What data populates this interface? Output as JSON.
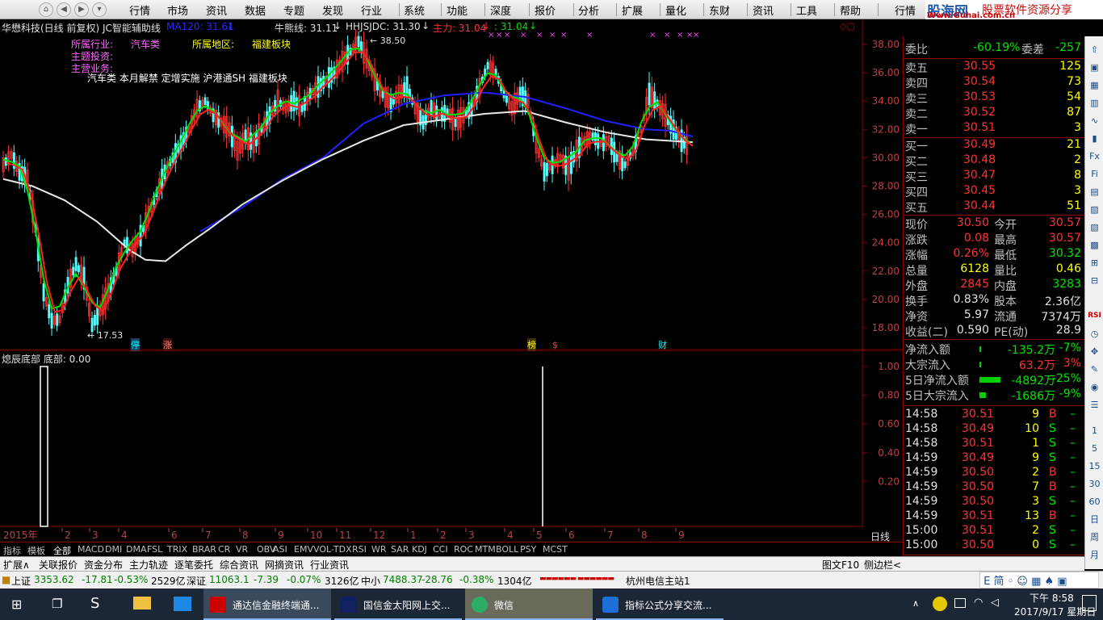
{
  "menubar": {
    "items": [
      "行情",
      "市场",
      "资讯",
      "数据",
      "专题",
      "发现",
      "行业",
      "系统",
      "功能",
      "深度",
      "报价",
      "分析",
      "扩展",
      "量化",
      "东财",
      "资讯",
      "工具",
      "帮助",
      "行情"
    ],
    "logo_main": "股海网",
    "logo_slogan": "股票软件资源分享",
    "logo_url": "Www.Guhai.com.cn"
  },
  "chart_header": {
    "title": "华懋科技(日线 前复权) JC智能辅助线",
    "ma120": "MA120: 31.61",
    "niu": "牛熊线: 31.11",
    "hhjs": "HHJSJDC: 31.30",
    "zhuli": "主力: 31.04",
    "extra": ": 31.04"
  },
  "info": {
    "industry_label": "所属行业:",
    "industry_value": "汽车类",
    "region_label": "所属地区:",
    "region_value": "福建板块",
    "invest_label": "主题投资:",
    "business_label": "主营业务:",
    "concepts": "汽车类 本月解禁 定增实施 沪港通SH 福建板块"
  },
  "markers": {
    "high": "38.50",
    "low": "17.53",
    "m1": "停",
    "m2": "涨",
    "m3": "榜",
    "m4": "$",
    "m5": "财"
  },
  "chart_data": [
    {
      "type": "line",
      "title": "华懋科技(日线 前复权)",
      "ylim": [
        17,
        39
      ],
      "ticks_y": [
        "38.00",
        "36.00",
        "34.00",
        "32.00",
        "30.00",
        "28.00",
        "26.00",
        "24.00",
        "22.00",
        "20.00",
        "18.00"
      ],
      "x_tick_labels": [
        "2015年",
        "2",
        "3",
        "4",
        "6",
        "7",
        "8",
        "9",
        "10",
        "11",
        "12",
        "1",
        "2",
        "3",
        "4",
        "5",
        "6",
        "7",
        "8",
        "9"
      ],
      "series": [
        {
          "name": "MA120",
          "color": "#2020ff"
        },
        {
          "name": "牛熊线",
          "color": "#e8e8e8"
        },
        {
          "name": "HHJSJDC",
          "color": "#00e000"
        },
        {
          "name": "主力",
          "color": "#ff2020"
        }
      ]
    },
    {
      "type": "bar",
      "title": "熄辰底部",
      "legend": "底部: 0.00",
      "ylim": [
        0,
        1.0
      ],
      "ticks_y": [
        "1.00",
        "0.80",
        "0.60",
        "0.40",
        "0.20"
      ]
    }
  ],
  "subchart": {
    "title": "熄辰底部 底部: 0.00"
  },
  "period_label": "日线",
  "quote": {
    "weibi_label": "委比",
    "weibi": "-60.19%",
    "weicha_label": "委差",
    "weicha": "-257",
    "sell": [
      {
        "label": "卖五",
        "price": "30.55",
        "vol": "125"
      },
      {
        "label": "卖四",
        "price": "30.54",
        "vol": "73"
      },
      {
        "label": "卖三",
        "price": "30.53",
        "vol": "54"
      },
      {
        "label": "卖二",
        "price": "30.52",
        "vol": "87"
      },
      {
        "label": "卖一",
        "price": "30.51",
        "vol": "3"
      }
    ],
    "buy": [
      {
        "label": "买一",
        "price": "30.49",
        "vol": "21"
      },
      {
        "label": "买二",
        "price": "30.48",
        "vol": "2"
      },
      {
        "label": "买三",
        "price": "30.47",
        "vol": "8"
      },
      {
        "label": "买四",
        "price": "30.45",
        "vol": "3"
      },
      {
        "label": "买五",
        "price": "30.44",
        "vol": "51"
      }
    ],
    "stats": [
      {
        "l1": "现价",
        "v1": "30.50",
        "l2": "今开",
        "v2": "30.57"
      },
      {
        "l1": "涨跌",
        "v1": "0.08",
        "l2": "最高",
        "v2": "30.57"
      },
      {
        "l1": "涨幅",
        "v1": "0.26%",
        "l2": "最低",
        "v2": "30.32"
      },
      {
        "l1": "总量",
        "v1": "6128",
        "l2": "量比",
        "v2": "0.46"
      },
      {
        "l1": "外盘",
        "v1": "2845",
        "l2": "内盘",
        "v2": "3283"
      },
      {
        "l1": "换手",
        "v1": "0.83%",
        "l2": "股本",
        "v2": "2.36亿"
      },
      {
        "l1": "净资",
        "v1": "5.97",
        "l2": "流通",
        "v2": "7374万"
      },
      {
        "l1": "收益(二)",
        "v1": "0.590",
        "l2": "PE(动)",
        "v2": "28.9"
      }
    ],
    "flows": [
      {
        "label": "净流入额",
        "value": "-135.2万",
        "pct": "-7%"
      },
      {
        "label": "大宗流入",
        "value": "63.2万",
        "pct": "3%"
      },
      {
        "label": "5日净流入额",
        "value": "-4892万",
        "pct": "-25%"
      },
      {
        "label": "5日大宗流入",
        "value": "-1686万",
        "pct": "-9%"
      }
    ],
    "ticks": [
      {
        "t": "14:58",
        "p": "30.51",
        "v": "9",
        "s": "B"
      },
      {
        "t": "14:58",
        "p": "30.49",
        "v": "10",
        "s": "S"
      },
      {
        "t": "14:58",
        "p": "30.51",
        "v": "1",
        "s": "S"
      },
      {
        "t": "14:59",
        "p": "30.49",
        "v": "9",
        "s": "S"
      },
      {
        "t": "14:59",
        "p": "30.50",
        "v": "2",
        "s": "B"
      },
      {
        "t": "14:59",
        "p": "30.50",
        "v": "7",
        "s": "B"
      },
      {
        "t": "14:59",
        "p": "30.50",
        "v": "3",
        "s": "S"
      },
      {
        "t": "14:59",
        "p": "30.51",
        "v": "13",
        "s": "B"
      },
      {
        "t": "15:00",
        "p": "30.51",
        "v": "2",
        "s": "S"
      },
      {
        "t": "15:00",
        "p": "30.50",
        "v": "0",
        "s": "S"
      }
    ],
    "bottom_tabs": [
      "笔",
      "价",
      "细",
      "势",
      "联",
      "值",
      "主",
      "筹"
    ]
  },
  "sidebar_labels": [
    "1",
    "5",
    "15",
    "30",
    "60",
    "日",
    "周",
    "月"
  ],
  "indicator_tabs": [
    "指标",
    "模板",
    "全部",
    "MACD",
    "DMI",
    "DMA",
    "FSL",
    "TRIX",
    "BRAR",
    "CR",
    "VR",
    "OBV",
    "ASI",
    "EMV",
    "VOL-TDX",
    "RSI",
    "WR",
    "SAR",
    "KDJ",
    "CCI",
    "ROC",
    "MTM",
    "BOLL",
    "PSY",
    "MCST"
  ],
  "bottom_tabs": [
    "扩展∧",
    "关联报价",
    "资金分布",
    "主力轨迹",
    "逐笔委托",
    "综合资讯",
    "网摘资讯",
    "行业资讯"
  ],
  "bottom_right": [
    "图文F10",
    "侧边栏<"
  ],
  "ticker": {
    "sh_label": "上证",
    "sh_val": "3353.62",
    "sh_chg": "-17.81",
    "sh_pct": "-0.53%",
    "sh_amt": "2529亿",
    "sz_label": "深证",
    "sz_val": "11063.1",
    "sz_chg": "-7.39",
    "sz_pct": "-0.07%",
    "sz_amt": "3126亿",
    "zx_label": "中小",
    "zx_val": "7488.37",
    "zx_chg": "-28.76",
    "zx_pct": "-0.38%",
    "zx_amt": "1304亿",
    "station": "杭州电信主站1"
  },
  "taskbar": {
    "apps": [
      "通达信金融终端通...",
      "国信金太阳网上交...",
      "微信",
      "指标公式分享交流..."
    ],
    "time": "下午 8:58",
    "date": "2017/9/17 星期日"
  }
}
